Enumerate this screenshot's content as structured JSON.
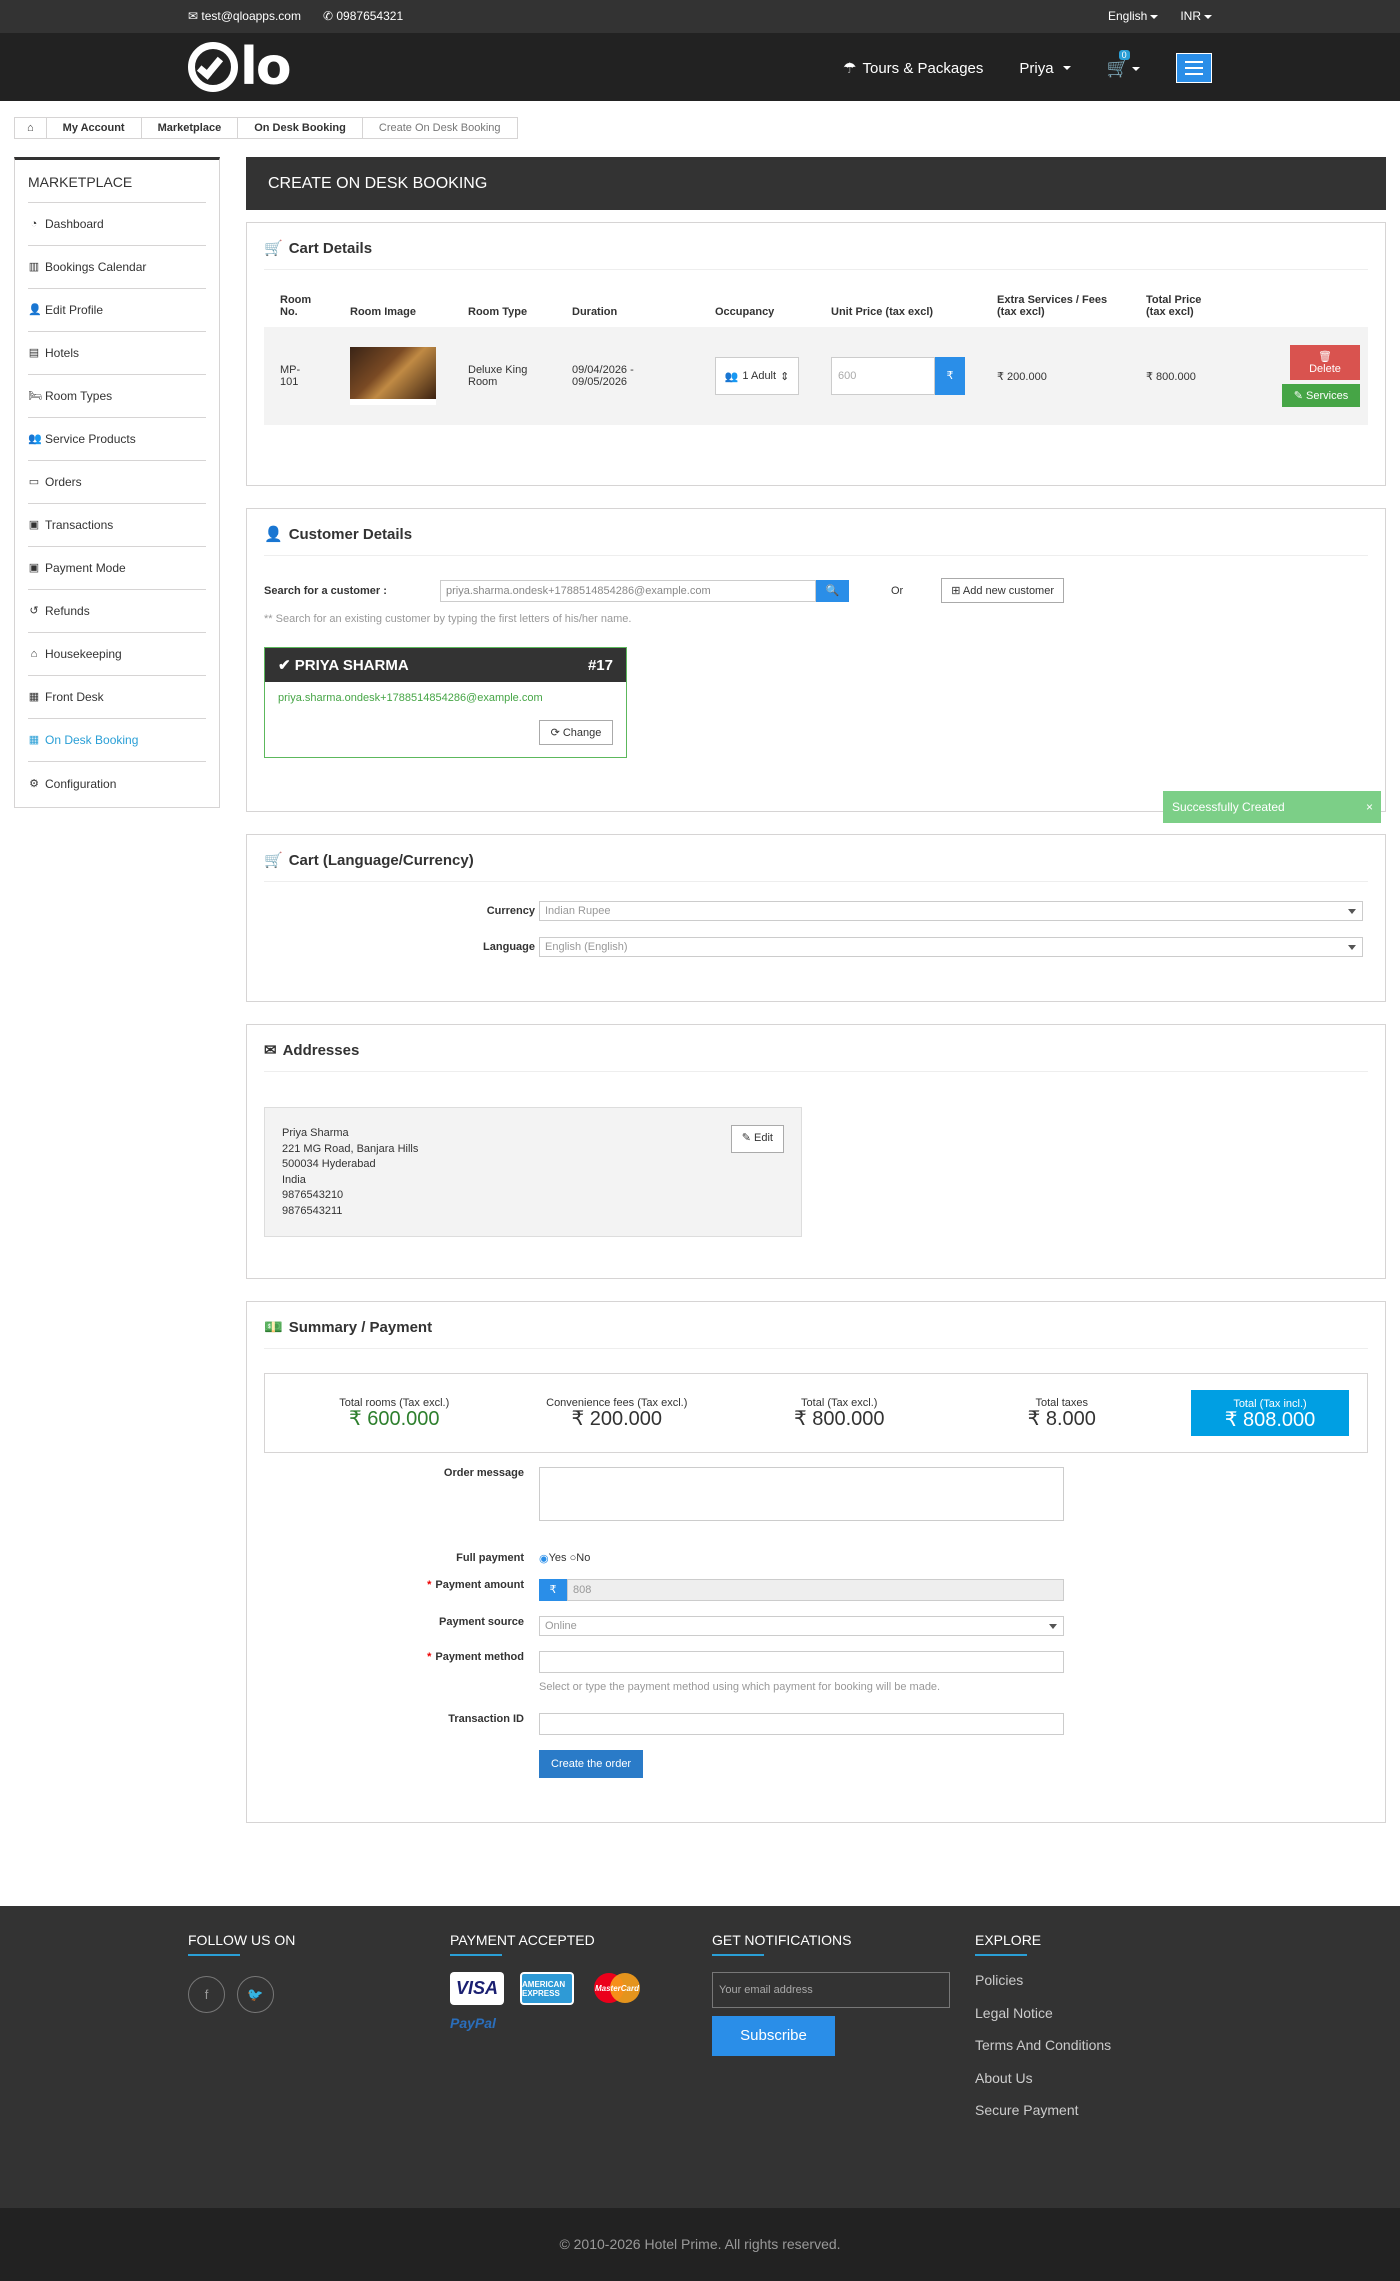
{
  "topbar": {
    "email": "test@qloapps.com",
    "phone": "0987654321",
    "language": "English",
    "currency": "INR"
  },
  "header": {
    "logo_text": "lo",
    "nav_tours": "Tours & Packages",
    "user": "Priya",
    "cart_count": "0"
  },
  "breadcrumb": {
    "items": [
      "My Account",
      "Marketplace",
      "On Desk Booking"
    ],
    "current": "Create On Desk Booking"
  },
  "sidebar": {
    "title": "MARKETPLACE",
    "items": [
      {
        "label": "Dashboard",
        "icon": "dashboard-icon"
      },
      {
        "label": "Bookings Calendar",
        "icon": "bar-chart-icon"
      },
      {
        "label": "Edit Profile",
        "icon": "user-icon"
      },
      {
        "label": "Hotels",
        "icon": "building-icon"
      },
      {
        "label": "Room Types",
        "icon": "bed-icon"
      },
      {
        "label": "Service Products",
        "icon": "user-plus-icon"
      },
      {
        "label": "Orders",
        "icon": "credit-card-icon"
      },
      {
        "label": "Transactions",
        "icon": "money-icon"
      },
      {
        "label": "Payment Mode",
        "icon": "money-icon"
      },
      {
        "label": "Refunds",
        "icon": "undo-icon"
      },
      {
        "label": "Housekeeping",
        "icon": "home-icon"
      },
      {
        "label": "Front Desk",
        "icon": "desk-icon"
      },
      {
        "label": "On Desk Booking",
        "icon": "calendar-icon"
      },
      {
        "label": "Configuration",
        "icon": "gear-icon"
      }
    ]
  },
  "page": {
    "title": "CREATE ON DESK BOOKING"
  },
  "cart": {
    "title": "Cart Details",
    "headers": [
      "Room No.",
      "Room Image",
      "Room Type",
      "Duration",
      "Occupancy",
      "Unit Price (tax excl)",
      "Extra Services / Fees (tax excl)",
      "Total Price (tax excl)"
    ],
    "row": {
      "room_no": "MP-101",
      "room_type": "Deluxe King Room",
      "duration": "09/04/2026 - 09/05/2026",
      "occupancy": "1 Adult",
      "unit_price": "600",
      "currency_symbol": "₹",
      "extra": "₹ 200.000",
      "total": "₹ 800.000"
    },
    "delete_label": "Delete",
    "services_label": "Services"
  },
  "customer": {
    "title": "Customer Details",
    "search_label": "Search for a customer :",
    "search_value": "priya.sharma.ondesk+1788514854286@example.com",
    "or": "Or",
    "add_new": "Add new customer",
    "hint": "** Search for an existing customer by typing the first letters of his/her name.",
    "name": "PRIYA SHARMA",
    "id": "#17",
    "email": "priya.sharma.ondesk+1788514854286@example.com",
    "change": "Change"
  },
  "toast": {
    "message": "Successfully Created",
    "close": "×"
  },
  "lang": {
    "title": "Cart (Language/Currency)",
    "currency_label": "Currency",
    "currency_value": "Indian Rupee",
    "language_label": "Language",
    "language_value": "English (English)"
  },
  "addresses": {
    "title": "Addresses",
    "lines": [
      "Priya Sharma",
      "221 MG Road, Banjara Hills",
      "500034 Hyderabad",
      "India",
      "9876543210",
      "9876543211"
    ],
    "edit": "Edit"
  },
  "summary": {
    "title": "Summary / Payment",
    "items": [
      {
        "label": "Total rooms (Tax excl.)",
        "value": "₹ 600.000"
      },
      {
        "label": "Convenience fees (Tax excl.)",
        "value": "₹ 200.000"
      },
      {
        "label": "Total (Tax excl.)",
        "value": "₹ 800.000"
      },
      {
        "label": "Total taxes",
        "value": "₹ 8.000"
      },
      {
        "label": "Total (Tax incl.)",
        "value": "₹ 808.000"
      }
    ],
    "order_message_label": "Order message",
    "full_payment_label": "Full payment",
    "yes": "Yes",
    "no": "No",
    "payment_amount_label": "Payment amount",
    "payment_amount": "808",
    "payment_source_label": "Payment source",
    "payment_source": "Online",
    "payment_method_label": "Payment method",
    "payment_method_hint": "Select or type the payment method using which payment for booking will be made.",
    "transaction_label": "Transaction ID",
    "create_btn": "Create the order"
  },
  "footer": {
    "follow": "FOLLOW US ON",
    "payment": "PAYMENT ACCEPTED",
    "notifications": "GET NOTIFICATIONS",
    "explore": "EXPLORE",
    "email_placeholder": "Your email address",
    "subscribe": "Subscribe",
    "paypal": "PayPal",
    "links": [
      "Policies",
      "Legal Notice",
      "Terms And Conditions",
      "About Us",
      "Secure Payment"
    ],
    "copyright": "© 2010-2026  Hotel Prime.  All rights reserved.",
    "cards": {
      "visa": "VISA",
      "amex": "AMERICAN EXPRESS",
      "mc": "MasterCard"
    }
  },
  "colors": {
    "accent": "#2a8ee8",
    "header_bg": "#222222",
    "success": "#46a546",
    "danger": "#d9534f",
    "highlight": "#009fe3"
  }
}
